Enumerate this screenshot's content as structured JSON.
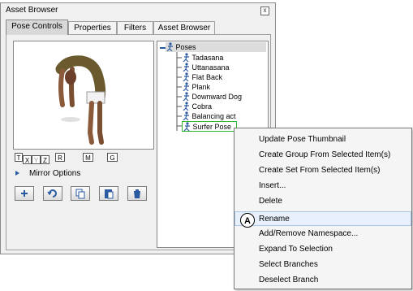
{
  "window": {
    "title": "Asset Browser",
    "close_glyph": "x"
  },
  "tabs": [
    {
      "label": "Pose Controls",
      "active": true
    },
    {
      "label": "Properties"
    },
    {
      "label": "Filters"
    },
    {
      "label": "Asset Browser"
    }
  ],
  "axis_buttons": [
    "T",
    "X",
    "Y",
    "Z",
    "R",
    "M",
    "G"
  ],
  "mirror_options": "Mirror Options",
  "toolbar_icons": [
    "add-icon",
    "refresh-icon",
    "copy-icon",
    "paste-icon",
    "trash-icon"
  ],
  "tree": {
    "root": "Poses",
    "items": [
      "Tadasana",
      "Uttanasana",
      "Flat Back",
      "Plank",
      "Downward Dog",
      "Cobra",
      "Balancing act",
      "Surfer Pose"
    ],
    "selected": "Surfer Pose"
  },
  "context_menu": {
    "items": [
      "Update Pose Thumbnail",
      "Create Group From Selected Item(s)",
      "Create Set From Selected Item(s)",
      "Insert...",
      "Delete",
      "Rename",
      "Add/Remove Namespace...",
      "Expand To Selection",
      "Select Branches",
      "Deselect Branch"
    ],
    "highlighted": "Rename"
  },
  "callout_label": "A",
  "colors": {
    "accent": "#2a5aa0",
    "selection_border": "#2db52d",
    "menu_highlight": "#e8f1fb"
  }
}
